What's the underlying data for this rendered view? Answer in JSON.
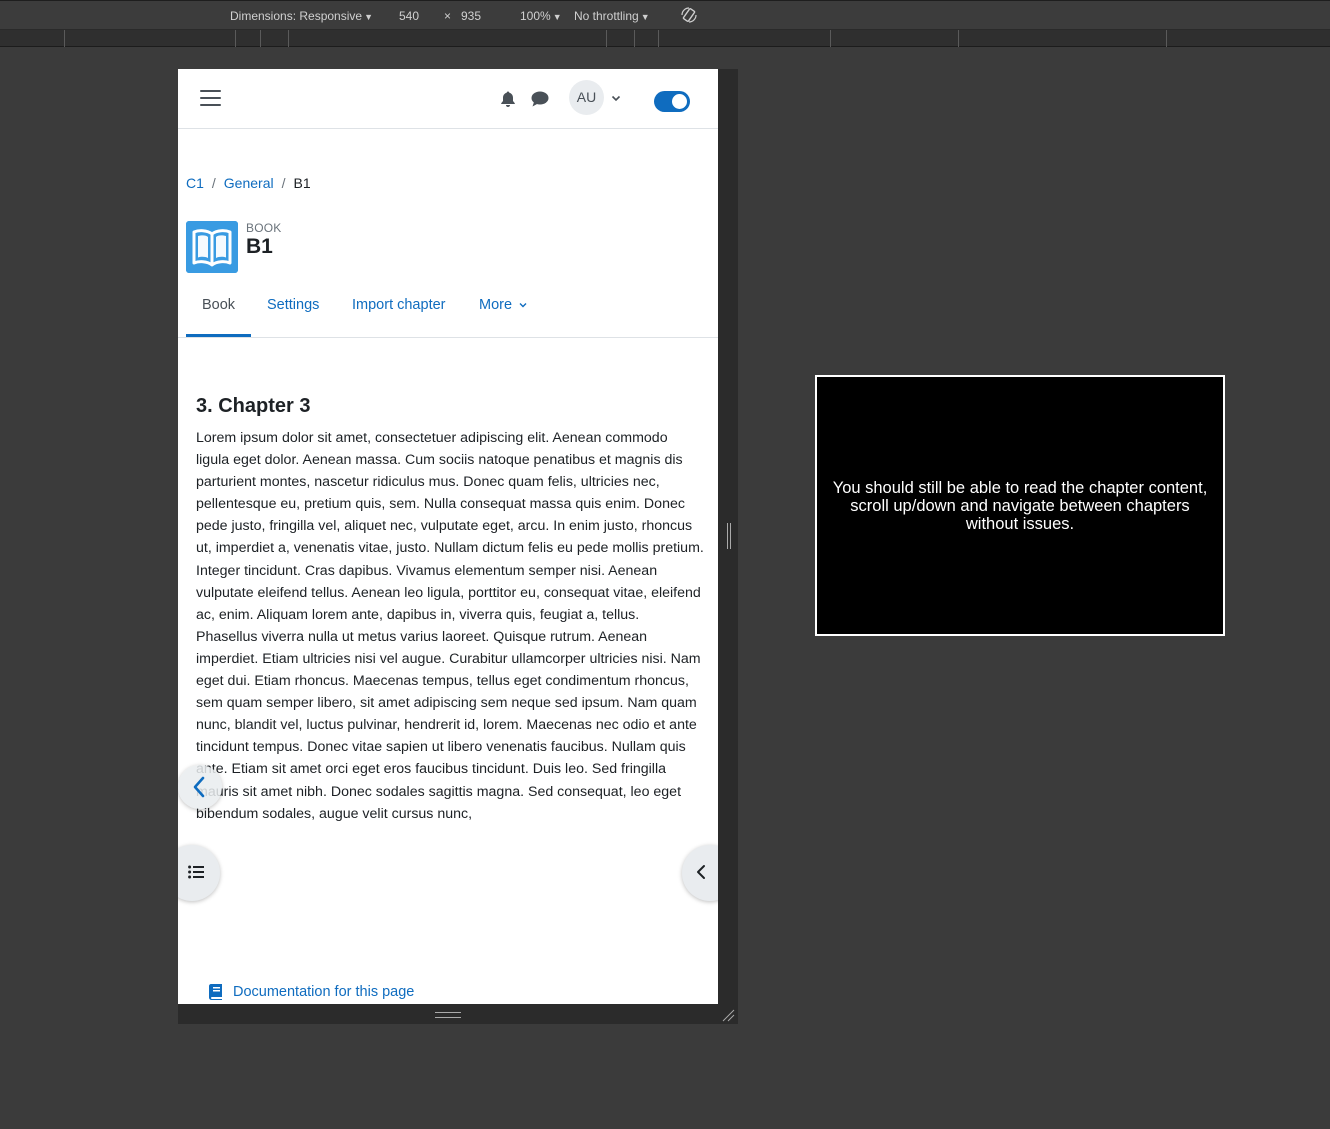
{
  "devtools": {
    "dimensions_label": "Dimensions: Responsive",
    "width": "540",
    "times": "×",
    "height": "935",
    "zoom": "100%",
    "throttling": "No throttling"
  },
  "navbar": {
    "avatar_initials": "AU",
    "edit_mode_on": true
  },
  "breadcrumb": {
    "items": [
      "C1",
      "General",
      "B1"
    ],
    "separator": "/"
  },
  "activity": {
    "kicker": "BOOK",
    "title": "B1"
  },
  "tabs": [
    {
      "label": "Book",
      "active": true
    },
    {
      "label": "Settings",
      "active": false
    },
    {
      "label": "Import chapter",
      "active": false
    },
    {
      "label": "More",
      "active": false
    }
  ],
  "chapter": {
    "title": "3. Chapter 3",
    "body": "Lorem ipsum dolor sit amet, consectetuer adipiscing elit. Aenean commodo ligula eget dolor. Aenean massa. Cum sociis natoque penatibus et magnis dis parturient montes, nascetur ridiculus mus. Donec quam felis, ultricies nec, pellentesque eu, pretium quis, sem. Nulla consequat massa quis enim. Donec pede justo, fringilla vel, aliquet nec, vulputate eget, arcu. In enim justo, rhoncus ut, imperdiet a, venenatis vitae, justo. Nullam dictum felis eu pede mollis pretium. Integer tincidunt. Cras dapibus. Vivamus elementum semper nisi. Aenean vulputate eleifend tellus. Aenean leo ligula, porttitor eu, consequat vitae, eleifend ac, enim. Aliquam lorem ante, dapibus in, viverra quis, feugiat a, tellus. Phasellus viverra nulla ut metus varius laoreet. Quisque rutrum. Aenean imperdiet. Etiam ultricies nisi vel augue. Curabitur ullamcorper ultricies nisi. Nam eget dui. Etiam rhoncus. Maecenas tempus, tellus eget condimentum rhoncus, sem quam semper libero, sit amet adipiscing sem neque sed ipsum. Nam quam nunc, blandit vel, luctus pulvinar, hendrerit id, lorem. Maecenas nec odio et ante tincidunt tempus. Donec vitae sapien ut libero venenatis faucibus. Nullam quis ante. Etiam sit amet orci eget eros faucibus tincidunt. Duis leo. Sed fringilla mauris sit amet nibh. Donec sodales sagittis magna. Sed consequat, leo eget bibendum sodales, augue velit cursus nunc,"
  },
  "footer": {
    "doc_link": "Documentation for this page"
  },
  "overlay": {
    "message": "You should still be able to read the chapter content, scroll up/down and navigate between chapters without issues."
  },
  "colors": {
    "brand": "#0f6cbf",
    "book_icon": "#399be2"
  }
}
